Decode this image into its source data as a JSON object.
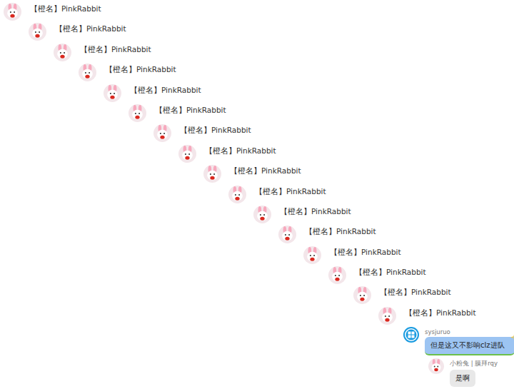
{
  "chat": {
    "messages": [
      {
        "kind": "name-only",
        "sender": "【橙名】PinkRabbit"
      },
      {
        "kind": "name-only",
        "sender": "【橙名】PinkRabbit"
      },
      {
        "kind": "name-only",
        "sender": "【橙名】PinkRabbit"
      },
      {
        "kind": "name-only",
        "sender": "【橙名】PinkRabbit"
      },
      {
        "kind": "name-only",
        "sender": "【橙名】PinkRabbit"
      },
      {
        "kind": "name-only",
        "sender": "【橙名】PinkRabbit"
      },
      {
        "kind": "name-only",
        "sender": "【橙名】PinkRabbit"
      },
      {
        "kind": "name-only",
        "sender": "【橙名】PinkRabbit"
      },
      {
        "kind": "name-only",
        "sender": "【橙名】PinkRabbit"
      },
      {
        "kind": "name-only",
        "sender": "【橙名】PinkRabbit"
      },
      {
        "kind": "name-only",
        "sender": "【橙名】PinkRabbit"
      },
      {
        "kind": "name-only",
        "sender": "【橙名】PinkRabbit"
      },
      {
        "kind": "name-only",
        "sender": "【橙名】PinkRabbit"
      },
      {
        "kind": "name-only",
        "sender": "【橙名】PinkRabbit"
      },
      {
        "kind": "name-only",
        "sender": "【橙名】PinkRabbit"
      },
      {
        "kind": "name-only",
        "sender": "【橙名】PinkRabbit"
      },
      {
        "kind": "logo-bubble",
        "sender": "sysjuruo",
        "text": "但是这又不影响clz进队",
        "color": "#9cc4f2"
      },
      {
        "kind": "bubble",
        "sender": "小粉兔 | 膜拜rqy",
        "text": "是啊",
        "color": "#e8e8e8"
      }
    ]
  }
}
